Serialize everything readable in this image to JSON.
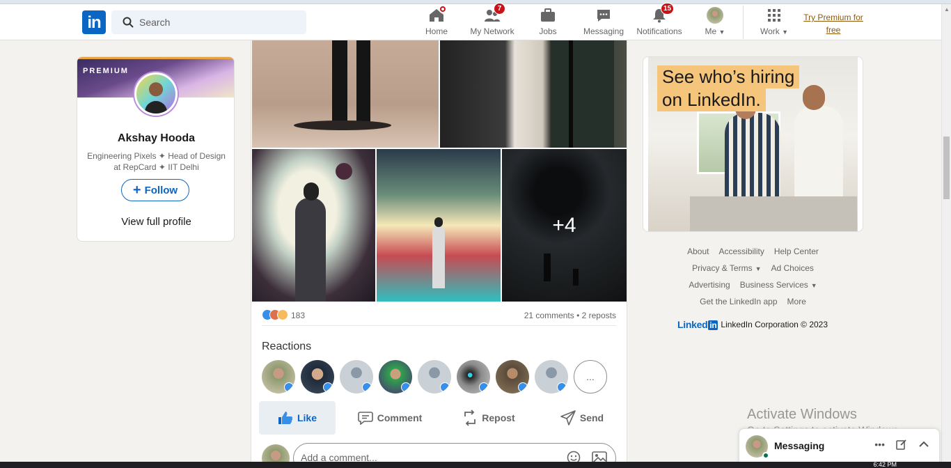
{
  "header": {
    "logo_text": "in",
    "search_placeholder": "Search",
    "nav": [
      {
        "label": "Home",
        "badge": "",
        "icon": "home-icon"
      },
      {
        "label": "My Network",
        "badge": "7",
        "icon": "network-icon"
      },
      {
        "label": "Jobs",
        "badge": "",
        "icon": "briefcase-icon"
      },
      {
        "label": "Messaging",
        "badge": "",
        "icon": "chat-icon"
      },
      {
        "label": "Notifications",
        "badge": "15",
        "icon": "bell-icon"
      },
      {
        "label": "Me",
        "badge": "",
        "icon": "avatar"
      },
      {
        "label": "Work",
        "badge": "",
        "icon": "grid-icon"
      }
    ],
    "premium_line1": "Try Premium for",
    "premium_line2": "free"
  },
  "profile": {
    "tag": "PREMIUM",
    "name": "Akshay Hooda",
    "headline": "Engineering Pixels ✦ Head of Design at RepCard ✦ IIT Delhi",
    "follow_label": "Follow",
    "view_profile": "View full profile"
  },
  "post": {
    "more_images": "+4",
    "reaction_count": "183",
    "comments_reposts": "21 comments • 2 reposts",
    "reactions_title": "Reactions",
    "more_reactors": "...",
    "actions": {
      "like": "Like",
      "comment": "Comment",
      "repost": "Repost",
      "send": "Send"
    },
    "comment_placeholder": "Add a comment..."
  },
  "ad": {
    "line1": "See who’s hiring",
    "line2": "on LinkedIn."
  },
  "footer": {
    "rows": [
      [
        "About",
        "Accessibility",
        "Help Center"
      ],
      [
        "Privacy & Terms",
        "Ad Choices"
      ],
      [
        "Advertising",
        "Business Services"
      ],
      [
        "Get the LinkedIn app",
        "More"
      ]
    ],
    "brand_word": "Linked",
    "brand_box": "in",
    "copyright": "LinkedIn Corporation © 2023"
  },
  "watermark": {
    "title": "Activate Windows",
    "subtitle": "Go to Settings to activate Windows."
  },
  "messaging_dock": {
    "label": "Messaging"
  },
  "taskbar": {
    "clock": "6:42 PM"
  },
  "colors": {
    "brand": "#0a66c2",
    "badge": "#cc1016",
    "page_bg": "#f4f2ee",
    "premium_link": "#915907",
    "ad_highlight": "#f4c57b"
  }
}
